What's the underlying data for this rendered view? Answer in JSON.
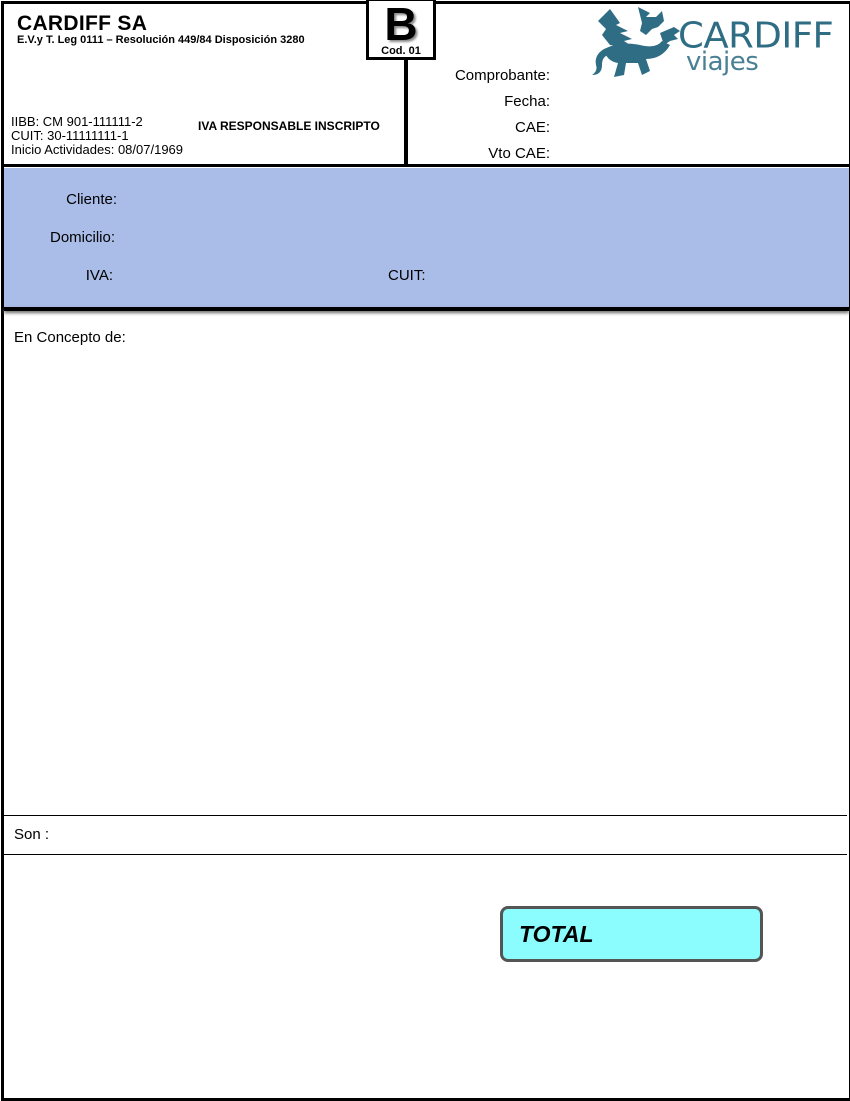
{
  "company": {
    "name": "CARDIFF SA",
    "legal": "E.V.y T. Leg 0111 – Resolución 449/84  Disposición 3280",
    "iibb": "IIBB: CM 901-111111-2",
    "cuit": "CUIT: 30-11111111-1",
    "inicio": "Inicio Actividades: 08/07/1969",
    "iva_condition": "IVA RESPONSABLE INSCRIPTO"
  },
  "voucher_type": {
    "letter": "B",
    "code": "Cod. 01"
  },
  "voucher_fields": {
    "comprobante": "Comprobante:",
    "fecha": "Fecha:",
    "cae": "CAE:",
    "vto_cae": "Vto CAE:"
  },
  "logo": {
    "word": "CARDIFF",
    "sub": "viajes",
    "color": "#2f6d84"
  },
  "client": {
    "cliente": "Cliente:",
    "domicilio": "Domicilio:",
    "iva": "IVA:",
    "cuit": "CUIT:",
    "band_color": "#a9bde8"
  },
  "body": {
    "concepto": "En Concepto de:",
    "son": "Son :"
  },
  "total": {
    "label": "TOTAL",
    "color": "#8cfdfe"
  }
}
